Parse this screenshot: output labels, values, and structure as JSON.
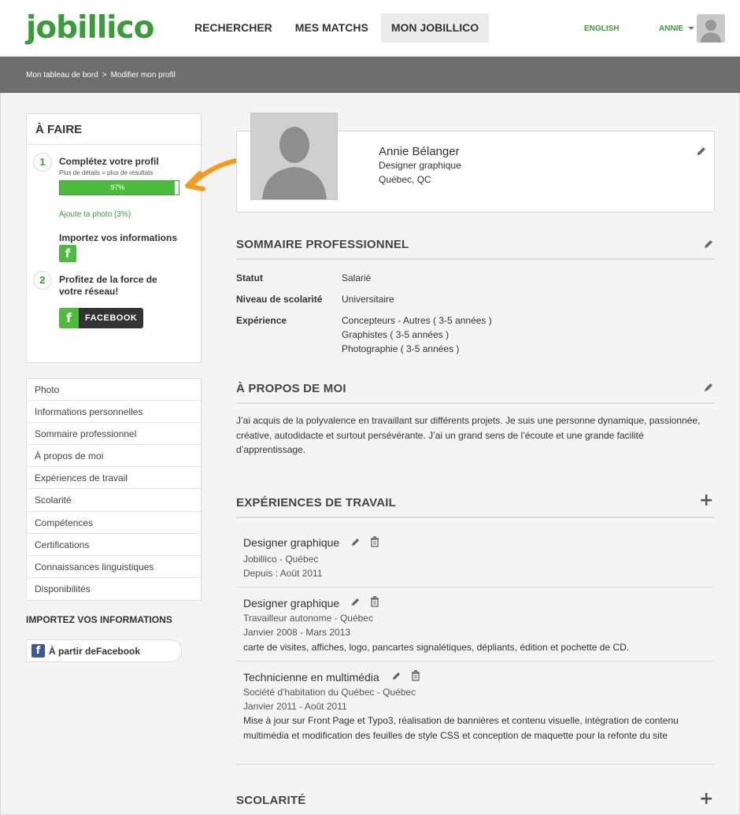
{
  "header": {
    "logo": "jobillico",
    "nav": [
      "RECHERCHER",
      "MES MATCHS",
      "MON JOBILLICO"
    ],
    "active_nav": "MON JOBILLICO",
    "language": "ENGLISH",
    "user_name": "ANNIE"
  },
  "breadcrumb": {
    "items": [
      "Mon tableau de bord",
      "Modifier mon profil"
    ],
    "separator": ">"
  },
  "todo": {
    "title": "À FAIRE",
    "step1": {
      "number": "1",
      "title": "Complétez votre profil",
      "subtitle": "Plus de détails = plus de résultats",
      "progress_label": "97%",
      "progress_value": 0.97,
      "photo_link": "Ajoute ta photo (3%)",
      "import_label": "Importez vos informations",
      "fb_glyph": "f"
    },
    "step2": {
      "number": "2",
      "title_line1": "Profitez de la force de",
      "title_line2": "votre réseau!",
      "fb_glyph": "f",
      "button": "FACEBOOK"
    }
  },
  "side_menu": [
    "Photo",
    "Informations personnelles",
    "Sommaire professionnel",
    "À propos de moi",
    "Expériences de travail",
    "Scolarité",
    "Compétences",
    "Certifications",
    "Connaissances linguistiques",
    "Disponibilités"
  ],
  "import": {
    "title": "IMPORTEZ VOS INFORMATIONS",
    "fb_glyph": "f",
    "button": "À partir deFacebook"
  },
  "profile": {
    "name": "Annie Bélanger",
    "title": "Designer graphique",
    "city": "Québec, QC"
  },
  "summary": {
    "heading": "SOMMAIRE PROFESSIONNEL",
    "status_label": "Statut",
    "status_value": "Salarié",
    "education_label": "Niveau de scolarité",
    "education_value": "Universitaire",
    "experience_label": "Expérience",
    "experience_values": [
      "Concepteurs - Autres ( 3-5 années )",
      "Graphistes ( 3-5 années )",
      "Photographie ( 3-5 années )"
    ]
  },
  "about": {
    "heading": "À PROPOS DE MOI",
    "text": "J’ai acquis de la polyvalence en travaillant sur différents projets. Je suis une personne dynamique, passionnée, créative, autodidacte et surtout persévérante. J’ai un grand sens de l’écoute et une grande facilité d’apprentissage."
  },
  "experiences": {
    "heading": "EXPÉRIENCES DE TRAVAIL",
    "add_glyph": "+",
    "items": [
      {
        "title": "Designer graphique",
        "company": "Jobillico - Québec",
        "dates": "Depuis : Août 2011",
        "desc": ""
      },
      {
        "title": "Designer graphique",
        "company": "Travailleur autonome - Québec",
        "dates": "Janvier 2008 - Mars 2013",
        "desc": "carte de visites, affiches, logo, pancartes signalétiques, dépliants, édition et pochette de CD."
      },
      {
        "title": "Technicienne en multimédia",
        "company": "Société d'habitation du Québec - Québec",
        "dates": "Janvier 2011 - Août 2011",
        "desc": "Mise à jour sur Front Page et Typo3, réalisation de bannières et contenu visuelle, intégration de contenu multimédia et modification des feuilles de style CSS et conception de maquette pour la refonte du site"
      }
    ]
  },
  "education": {
    "heading": "SCOLARITÉ",
    "add_glyph": "+"
  },
  "colors": {
    "brand_green": "#3a9b3a",
    "progress_green": "#4dbb3d",
    "arrow_orange": "#f39a1f",
    "breadcrumb_bar": "#6e6e6e"
  }
}
